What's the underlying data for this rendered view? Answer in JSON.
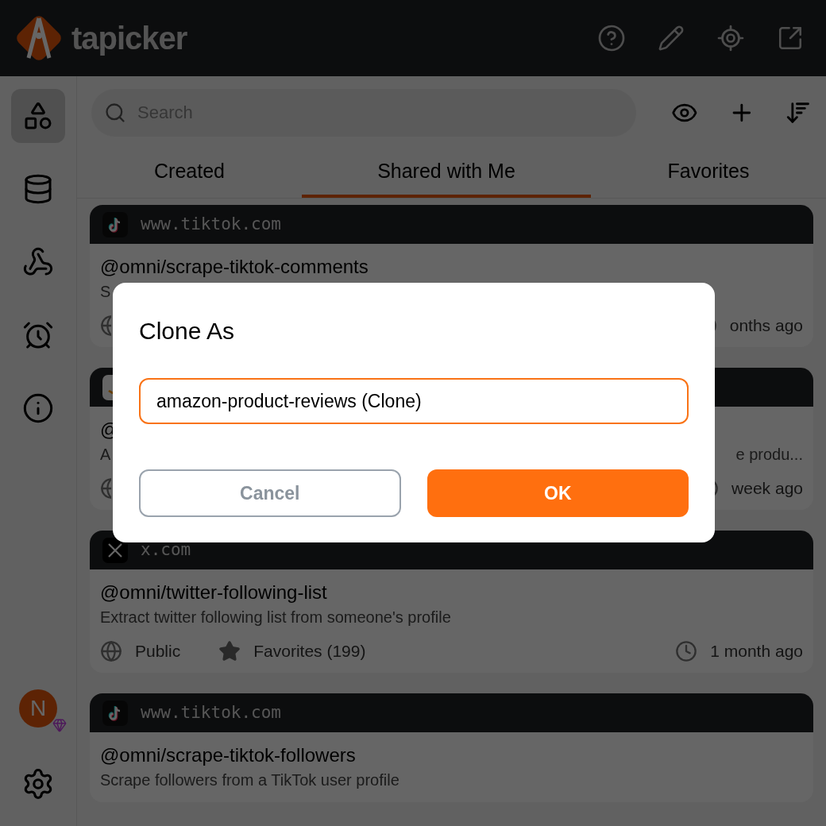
{
  "header": {
    "logo_text": "tapicker"
  },
  "sidebar": {
    "items": [
      {
        "kind": "shapes",
        "selected": true
      },
      {
        "kind": "database",
        "selected": false
      },
      {
        "kind": "webhook",
        "selected": false
      },
      {
        "kind": "alarm",
        "selected": false
      },
      {
        "kind": "info",
        "selected": false
      }
    ],
    "avatar": {
      "initial": "N"
    }
  },
  "search": {
    "placeholder": "Search"
  },
  "tabs": [
    {
      "label": "Created",
      "selected": false
    },
    {
      "label": "Shared with Me",
      "selected": true
    },
    {
      "label": "Favorites",
      "selected": false
    }
  ],
  "cards": [
    {
      "kind": "tiktok",
      "site": "www.tiktok.com",
      "title": "@omni/scrape-tiktok-comments",
      "description": "S",
      "footer": {
        "updated": "onths ago"
      }
    },
    {
      "kind": "amazon",
      "title": "@",
      "description": "A",
      "description_end": "e produ...",
      "footer": {
        "updated": "week ago"
      }
    },
    {
      "kind": "x",
      "site": "x.com",
      "title": "@omni/twitter-following-list",
      "description": "Extract twitter following list from someone's profile",
      "footer": {
        "visibility": "Public",
        "favorites": "Favorites (199)",
        "updated": "1 month ago"
      }
    },
    {
      "kind": "tiktok",
      "site": "www.tiktok.com",
      "title": "@omni/scrape-tiktok-followers",
      "description": "Scrape followers from a TikTok user profile"
    }
  ],
  "dialog": {
    "title": "Clone As",
    "value": "amazon-product-reviews (Clone)",
    "buttons": [
      {
        "kind": "secondary",
        "label": "Cancel"
      },
      {
        "kind": "primary",
        "label": "OK"
      }
    ]
  }
}
